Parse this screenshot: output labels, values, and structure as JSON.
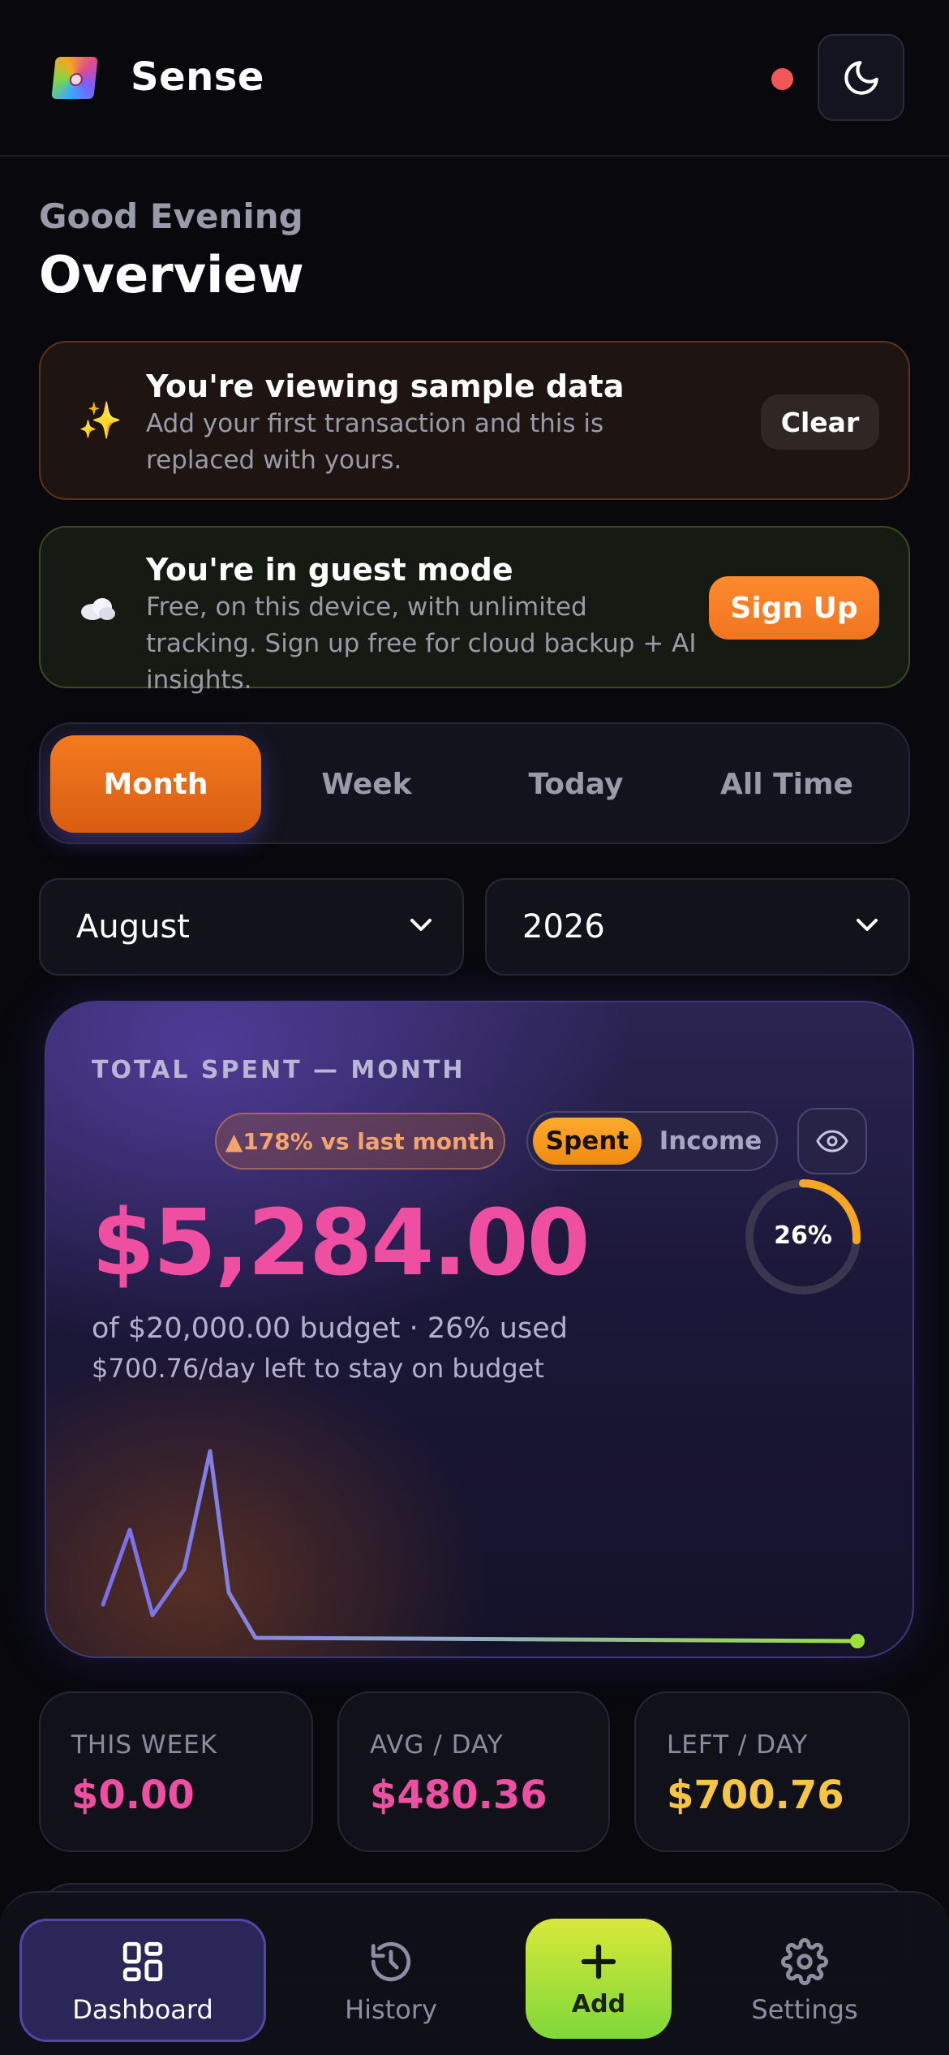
{
  "header": {
    "app_name": "Sense",
    "icons": {
      "logo": "app-logo",
      "theme": "moon-icon",
      "status": "status-dot"
    },
    "status_color": "#f25757"
  },
  "greeting": "Good Evening",
  "page_title": "Overview",
  "banners": {
    "sample": {
      "icon": "sparkles-icon",
      "title": "You're viewing sample data",
      "text": "Add your first transaction and this is replaced with yours.",
      "button": "Clear"
    },
    "guest": {
      "icon": "cloud-icon",
      "title": "You're in guest mode",
      "text": "Free, on this device, with unlimited tracking. Sign up free for cloud backup + AI insights.",
      "button": "Sign Up"
    }
  },
  "periods": [
    "Month",
    "Week",
    "Today",
    "All Time"
  ],
  "active_period": "Month",
  "selects": {
    "month": "August",
    "year": "2026"
  },
  "hero": {
    "label": "TOTAL SPENT — MONTH",
    "delta": "▲178% vs last month",
    "toggle": {
      "on": "Spent",
      "off": "Income"
    },
    "amount": "$5,284.00",
    "ring_label": "26%",
    "ring_percent": 26,
    "budget_line": "of $20,000.00 budget · 26% used",
    "perday_line": "$700.76/day left to stay on budget",
    "accent": "#ee4fa0"
  },
  "stats": [
    {
      "label": "THIS WEEK",
      "value": "$0.00",
      "color": "#ee4fa0"
    },
    {
      "label": "AVG / DAY",
      "value": "$480.36",
      "color": "#ee4fa0"
    },
    {
      "label": "LEFT / DAY",
      "value": "$700.76",
      "color": "#f7c544"
    }
  ],
  "nav": {
    "dashboard": "Dashboard",
    "history": "History",
    "add": "Add",
    "settings": "Settings"
  },
  "colors": {
    "background": "#08080d",
    "accent_orange": "#f47a1e",
    "accent_green": "#9ee03a",
    "accent_purple": "#7c6cf0"
  }
}
